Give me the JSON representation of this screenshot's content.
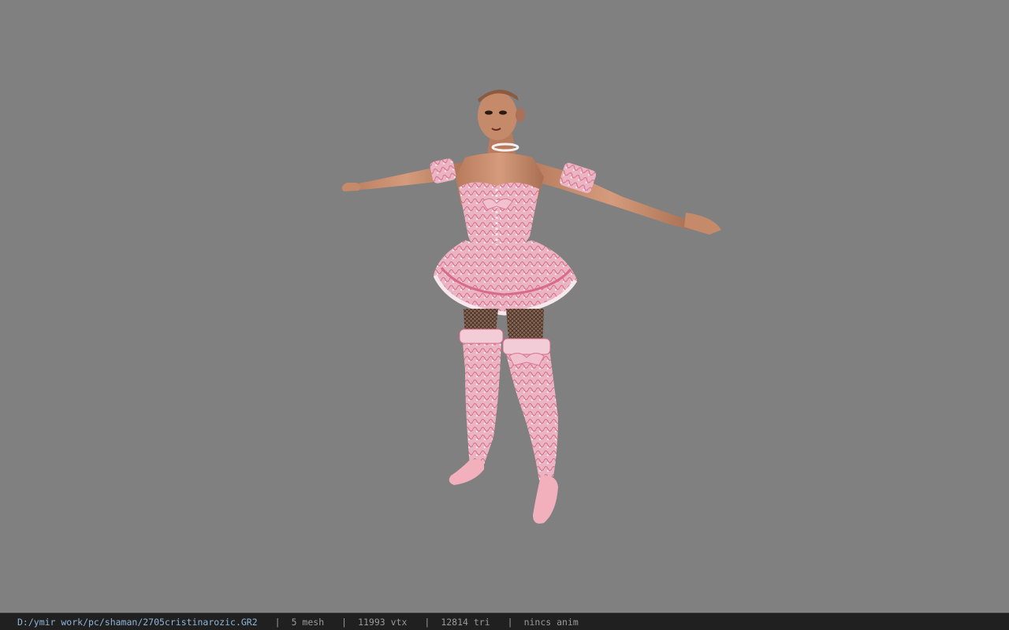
{
  "statusbar": {
    "file_path": "D:/ymir work/pc/shaman/2705cristinarozic.GR2",
    "separator": "|",
    "mesh": "5 mesh",
    "vertices": "11993 vtx",
    "triangles": "12814 tri",
    "animation": "nincs anim"
  },
  "colors": {
    "viewport_background": "#808080",
    "statusbar_background": "#202020",
    "path_text": "#8fb4d8",
    "stat_text": "#9a9a9a",
    "skin": "#c98f6f",
    "dress_pink": "#e7a3b4",
    "dress_white": "#f3e1e5",
    "stockings": "#5a4030"
  },
  "viewport": {
    "model_icon": "3d-character-model"
  }
}
